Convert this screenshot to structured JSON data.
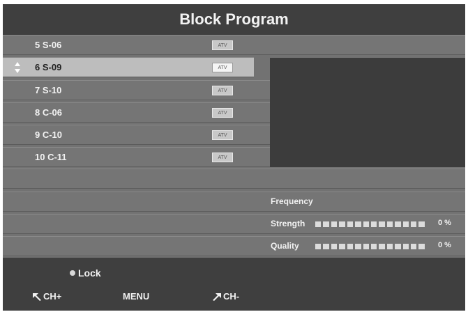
{
  "title": "Block Program",
  "programs": [
    {
      "label": "5 S-06",
      "tag": "ATV",
      "selected": false
    },
    {
      "label": "6 S-09",
      "tag": "ATV",
      "selected": true
    },
    {
      "label": "7 S-10",
      "tag": "ATV",
      "selected": false
    },
    {
      "label": "8 C-06",
      "tag": "ATV",
      "selected": false
    },
    {
      "label": "9 C-10",
      "tag": "ATV",
      "selected": false
    },
    {
      "label": "10 C-11",
      "tag": "ATV",
      "selected": false
    }
  ],
  "info": {
    "frequency_label": "Frequency",
    "strength_label": "Strength",
    "strength_value": "0 %",
    "strength_level": 0,
    "quality_label": "Quality",
    "quality_value": "0 %",
    "quality_level": 0
  },
  "footer": {
    "lock_label": "Lock",
    "ch_plus_label": "CH+",
    "menu_label": "MENU",
    "ch_minus_label": "CH-"
  }
}
